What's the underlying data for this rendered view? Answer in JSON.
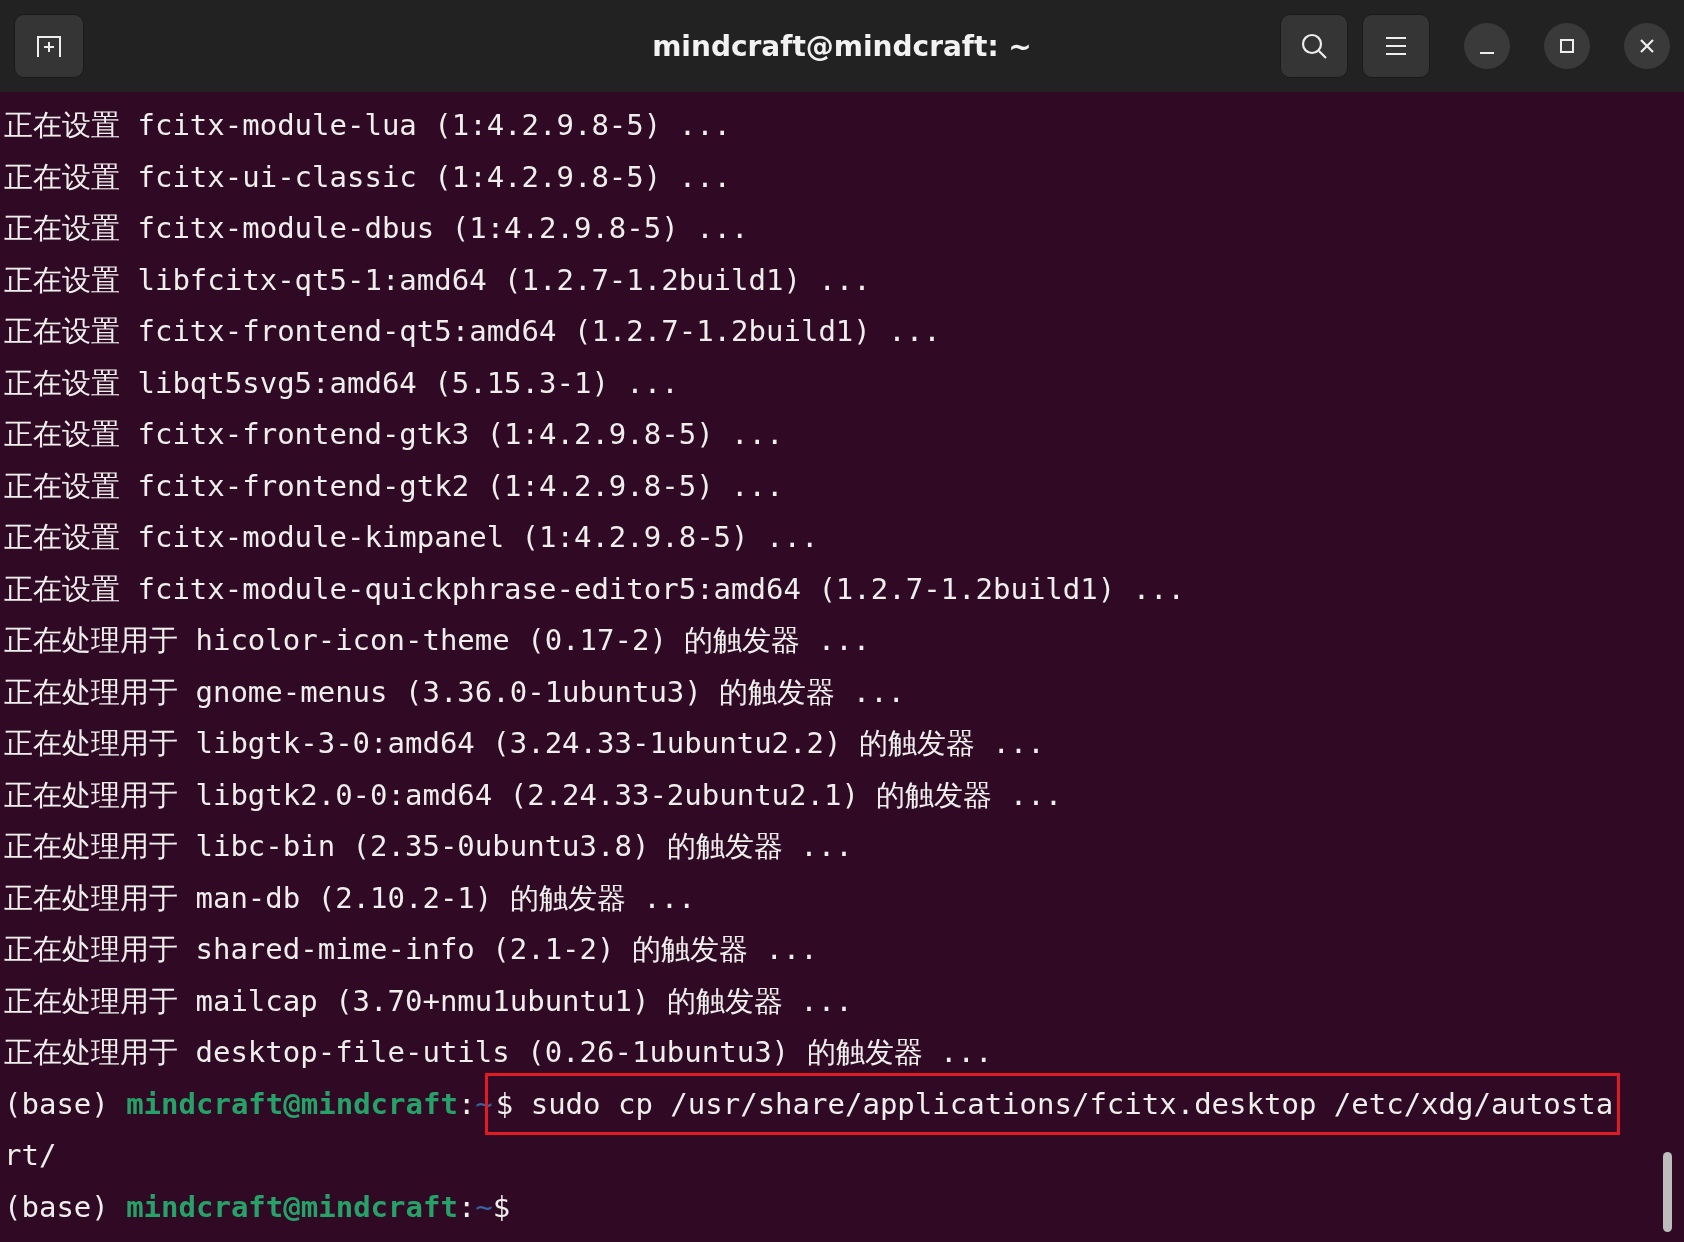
{
  "window": {
    "title": "mindcraft@mindcraft: ~"
  },
  "lines": [
    {
      "kind": "output",
      "text": "正在设置 fcitx-module-lua (1:4.2.9.8-5) ..."
    },
    {
      "kind": "output",
      "text": "正在设置 fcitx-ui-classic (1:4.2.9.8-5) ..."
    },
    {
      "kind": "output",
      "text": "正在设置 fcitx-module-dbus (1:4.2.9.8-5) ..."
    },
    {
      "kind": "output",
      "text": "正在设置 libfcitx-qt5-1:amd64 (1.2.7-1.2build1) ..."
    },
    {
      "kind": "output",
      "text": "正在设置 fcitx-frontend-qt5:amd64 (1.2.7-1.2build1) ..."
    },
    {
      "kind": "output",
      "text": "正在设置 libqt5svg5:amd64 (5.15.3-1) ..."
    },
    {
      "kind": "output",
      "text": "正在设置 fcitx-frontend-gtk3 (1:4.2.9.8-5) ..."
    },
    {
      "kind": "output",
      "text": "正在设置 fcitx-frontend-gtk2 (1:4.2.9.8-5) ..."
    },
    {
      "kind": "output",
      "text": "正在设置 fcitx-module-kimpanel (1:4.2.9.8-5) ..."
    },
    {
      "kind": "output",
      "text": "正在设置 fcitx-module-quickphrase-editor5:amd64 (1.2.7-1.2build1) ..."
    },
    {
      "kind": "output",
      "text": "正在处理用于 hicolor-icon-theme (0.17-2) 的触发器 ..."
    },
    {
      "kind": "output",
      "text": "正在处理用于 gnome-menus (3.36.0-1ubuntu3) 的触发器 ..."
    },
    {
      "kind": "output",
      "text": "正在处理用于 libgtk-3-0:amd64 (3.24.33-1ubuntu2.2) 的触发器 ..."
    },
    {
      "kind": "output",
      "text": "正在处理用于 libgtk2.0-0:amd64 (2.24.33-2ubuntu2.1) 的触发器 ..."
    },
    {
      "kind": "output",
      "text": "正在处理用于 libc-bin (2.35-0ubuntu3.8) 的触发器 ..."
    },
    {
      "kind": "output",
      "text": "正在处理用于 man-db (2.10.2-1) 的触发器 ..."
    },
    {
      "kind": "output",
      "text": "正在处理用于 shared-mime-info (2.1-2) 的触发器 ..."
    },
    {
      "kind": "output",
      "text": "正在处理用于 mailcap (3.70+nmu1ubuntu1) 的触发器 ..."
    },
    {
      "kind": "output",
      "text": "正在处理用于 desktop-file-utils (0.26-1ubuntu3) 的触发器 ..."
    },
    {
      "kind": "prompt",
      "env": "(base)",
      "user": "mindcraft@mindcraft",
      "sep": ":",
      "path": "~",
      "symbol": "$",
      "command": "sudo cp /usr/share/applications/fcitx.desktop /etc/xdg/autosta",
      "highlighted": true
    },
    {
      "kind": "output",
      "text": "rt/"
    },
    {
      "kind": "prompt",
      "env": "(base)",
      "user": "mindcraft@mindcraft",
      "sep": ":",
      "path": "~",
      "symbol": "$",
      "highlighted": false
    }
  ]
}
